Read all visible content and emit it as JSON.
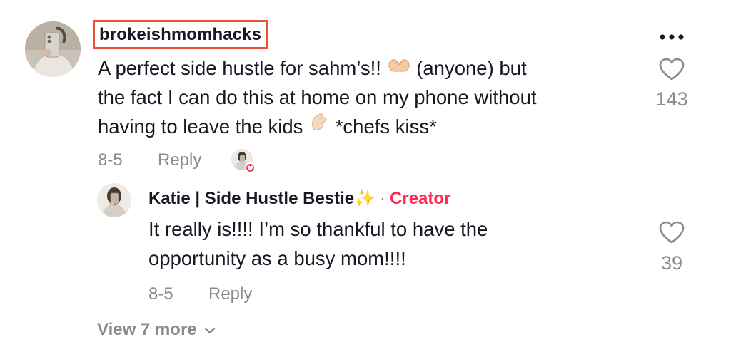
{
  "comment": {
    "username": "brokeishmomhacks",
    "text_line1_a": "A perfect side hustle for sahm’s!!",
    "text_line1_b": "(anyone) but",
    "text_line2": "the fact I can do this at home on my phone without",
    "text_line3_a": "having to leave the kids",
    "text_line3_b": "*chefs kiss*",
    "date": "8-5",
    "reply_label": "Reply",
    "like_count": "143",
    "emoji_1": "heart-hands-emoji",
    "emoji_2": "pinched-fingers-emoji"
  },
  "reply": {
    "author": "Katie | Side Hustle Bestie",
    "sparkle": "✨",
    "separator": "·",
    "creator_label": "Creator",
    "text_line1": "It really is!!!! I’m so thankful to have the",
    "text_line2": "opportunity as a busy mom!!!!",
    "date": "8-5",
    "reply_label": "Reply",
    "like_count": "39"
  },
  "view_more": {
    "label": "View 7 more"
  },
  "colors": {
    "highlight_box": "#e8503a",
    "creator": "#fe2c55",
    "muted": "#8a8b91",
    "text": "#161823"
  }
}
